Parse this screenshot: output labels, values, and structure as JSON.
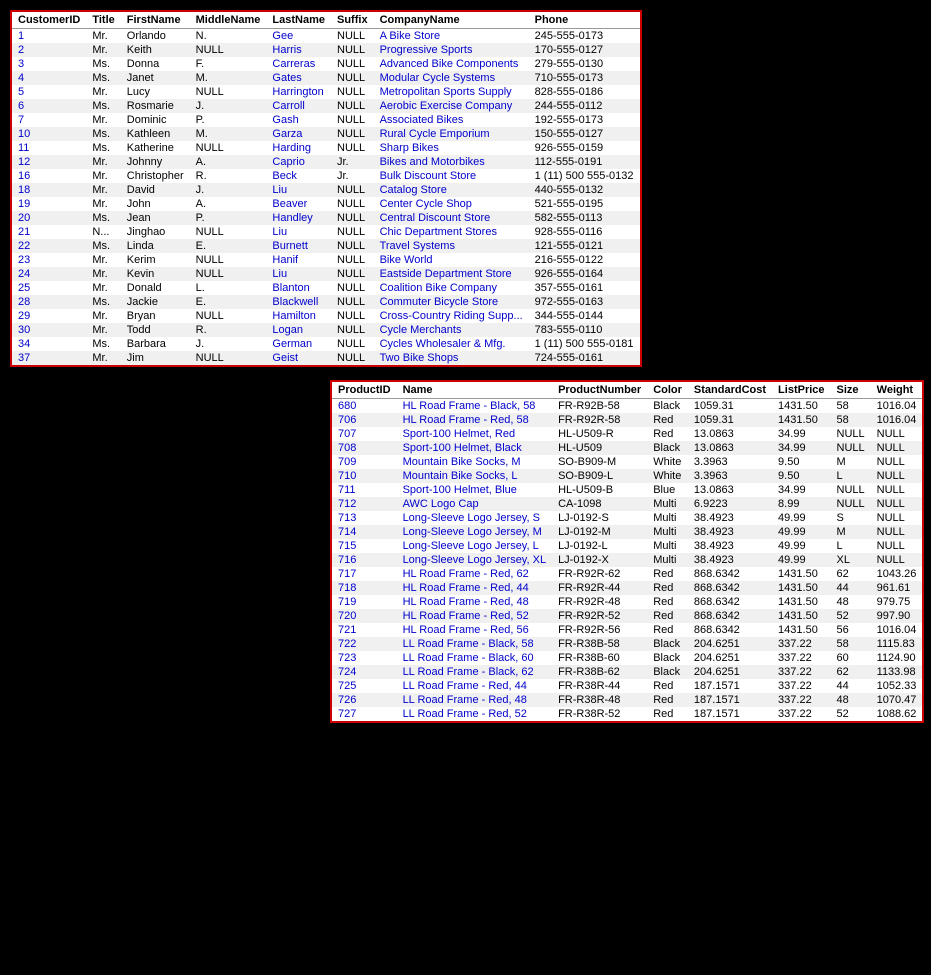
{
  "table1": {
    "columns": [
      "CustomerID",
      "Title",
      "FirstName",
      "MiddleName",
      "LastName",
      "Suffix",
      "CompanyName",
      "Phone"
    ],
    "rows": [
      [
        "1",
        "Mr.",
        "Orlando",
        "N.",
        "Gee",
        "NULL",
        "A Bike Store",
        "245-555-0173"
      ],
      [
        "2",
        "Mr.",
        "Keith",
        "NULL",
        "Harris",
        "NULL",
        "Progressive Sports",
        "170-555-0127"
      ],
      [
        "3",
        "Ms.",
        "Donna",
        "F.",
        "Carreras",
        "NULL",
        "Advanced Bike Components",
        "279-555-0130"
      ],
      [
        "4",
        "Ms.",
        "Janet",
        "M.",
        "Gates",
        "NULL",
        "Modular Cycle Systems",
        "710-555-0173"
      ],
      [
        "5",
        "Mr.",
        "Lucy",
        "NULL",
        "Harrington",
        "NULL",
        "Metropolitan Sports Supply",
        "828-555-0186"
      ],
      [
        "6",
        "Ms.",
        "Rosmarie",
        "J.",
        "Carroll",
        "NULL",
        "Aerobic Exercise Company",
        "244-555-0112"
      ],
      [
        "7",
        "Mr.",
        "Dominic",
        "P.",
        "Gash",
        "NULL",
        "Associated Bikes",
        "192-555-0173"
      ],
      [
        "10",
        "Ms.",
        "Kathleen",
        "M.",
        "Garza",
        "NULL",
        "Rural Cycle Emporium",
        "150-555-0127"
      ],
      [
        "11",
        "Ms.",
        "Katherine",
        "NULL",
        "Harding",
        "NULL",
        "Sharp Bikes",
        "926-555-0159"
      ],
      [
        "12",
        "Mr.",
        "Johnny",
        "A.",
        "Caprio",
        "Jr.",
        "Bikes and Motorbikes",
        "112-555-0191"
      ],
      [
        "16",
        "Mr.",
        "Christopher",
        "R.",
        "Beck",
        "Jr.",
        "Bulk Discount Store",
        "1 (11) 500 555-0132"
      ],
      [
        "18",
        "Mr.",
        "David",
        "J.",
        "Liu",
        "NULL",
        "Catalog Store",
        "440-555-0132"
      ],
      [
        "19",
        "Mr.",
        "John",
        "A.",
        "Beaver",
        "NULL",
        "Center Cycle Shop",
        "521-555-0195"
      ],
      [
        "20",
        "Ms.",
        "Jean",
        "P.",
        "Handley",
        "NULL",
        "Central Discount Store",
        "582-555-0113"
      ],
      [
        "21",
        "N...",
        "Jinghao",
        "NULL",
        "Liu",
        "NULL",
        "Chic Department Stores",
        "928-555-0116"
      ],
      [
        "22",
        "Ms.",
        "Linda",
        "E.",
        "Burnett",
        "NULL",
        "Travel Systems",
        "121-555-0121"
      ],
      [
        "23",
        "Mr.",
        "Kerim",
        "NULL",
        "Hanif",
        "NULL",
        "Bike World",
        "216-555-0122"
      ],
      [
        "24",
        "Mr.",
        "Kevin",
        "NULL",
        "Liu",
        "NULL",
        "Eastside Department Store",
        "926-555-0164"
      ],
      [
        "25",
        "Mr.",
        "Donald",
        "L.",
        "Blanton",
        "NULL",
        "Coalition Bike Company",
        "357-555-0161"
      ],
      [
        "28",
        "Ms.",
        "Jackie",
        "E.",
        "Blackwell",
        "NULL",
        "Commuter Bicycle Store",
        "972-555-0163"
      ],
      [
        "29",
        "Mr.",
        "Bryan",
        "NULL",
        "Hamilton",
        "NULL",
        "Cross-Country Riding Supp...",
        "344-555-0144"
      ],
      [
        "30",
        "Mr.",
        "Todd",
        "R.",
        "Logan",
        "NULL",
        "Cycle Merchants",
        "783-555-0110"
      ],
      [
        "34",
        "Ms.",
        "Barbara",
        "J.",
        "German",
        "NULL",
        "Cycles Wholesaler & Mfg.",
        "1 (11) 500 555-0181"
      ],
      [
        "37",
        "Mr.",
        "Jim",
        "NULL",
        "Geist",
        "NULL",
        "Two Bike Shops",
        "724-555-0161"
      ]
    ]
  },
  "table2": {
    "columns": [
      "ProductID",
      "Name",
      "ProductNumber",
      "Color",
      "StandardCost",
      "ListPrice",
      "Size",
      "Weight"
    ],
    "rows": [
      [
        "680",
        "HL Road Frame - Black, 58",
        "FR-R92B-58",
        "Black",
        "1059.31",
        "1431.50",
        "58",
        "1016.04"
      ],
      [
        "706",
        "HL Road Frame - Red, 58",
        "FR-R92R-58",
        "Red",
        "1059.31",
        "1431.50",
        "58",
        "1016.04"
      ],
      [
        "707",
        "Sport-100 Helmet, Red",
        "HL-U509-R",
        "Red",
        "13.0863",
        "34.99",
        "NULL",
        "NULL"
      ],
      [
        "708",
        "Sport-100 Helmet, Black",
        "HL-U509",
        "Black",
        "13.0863",
        "34.99",
        "NULL",
        "NULL"
      ],
      [
        "709",
        "Mountain Bike Socks, M",
        "SO-B909-M",
        "White",
        "3.3963",
        "9.50",
        "M",
        "NULL"
      ],
      [
        "710",
        "Mountain Bike Socks, L",
        "SO-B909-L",
        "White",
        "3.3963",
        "9.50",
        "L",
        "NULL"
      ],
      [
        "711",
        "Sport-100 Helmet, Blue",
        "HL-U509-B",
        "Blue",
        "13.0863",
        "34.99",
        "NULL",
        "NULL"
      ],
      [
        "712",
        "AWC Logo Cap",
        "CA-1098",
        "Multi",
        "6.9223",
        "8.99",
        "NULL",
        "NULL"
      ],
      [
        "713",
        "Long-Sleeve Logo Jersey, S",
        "LJ-0192-S",
        "Multi",
        "38.4923",
        "49.99",
        "S",
        "NULL"
      ],
      [
        "714",
        "Long-Sleeve Logo Jersey, M",
        "LJ-0192-M",
        "Multi",
        "38.4923",
        "49.99",
        "M",
        "NULL"
      ],
      [
        "715",
        "Long-Sleeve Logo Jersey, L",
        "LJ-0192-L",
        "Multi",
        "38.4923",
        "49.99",
        "L",
        "NULL"
      ],
      [
        "716",
        "Long-Sleeve Logo Jersey, XL",
        "LJ-0192-X",
        "Multi",
        "38.4923",
        "49.99",
        "XL",
        "NULL"
      ],
      [
        "717",
        "HL Road Frame - Red, 62",
        "FR-R92R-62",
        "Red",
        "868.6342",
        "1431.50",
        "62",
        "1043.26"
      ],
      [
        "718",
        "HL Road Frame - Red, 44",
        "FR-R92R-44",
        "Red",
        "868.6342",
        "1431.50",
        "44",
        "961.61"
      ],
      [
        "719",
        "HL Road Frame - Red, 48",
        "FR-R92R-48",
        "Red",
        "868.6342",
        "1431.50",
        "48",
        "979.75"
      ],
      [
        "720",
        "HL Road Frame - Red, 52",
        "FR-R92R-52",
        "Red",
        "868.6342",
        "1431.50",
        "52",
        "997.90"
      ],
      [
        "721",
        "HL Road Frame - Red, 56",
        "FR-R92R-56",
        "Red",
        "868.6342",
        "1431.50",
        "56",
        "1016.04"
      ],
      [
        "722",
        "LL Road Frame - Black, 58",
        "FR-R38B-58",
        "Black",
        "204.6251",
        "337.22",
        "58",
        "1115.83"
      ],
      [
        "723",
        "LL Road Frame - Black, 60",
        "FR-R38B-60",
        "Black",
        "204.6251",
        "337.22",
        "60",
        "1124.90"
      ],
      [
        "724",
        "LL Road Frame - Black, 62",
        "FR-R38B-62",
        "Black",
        "204.6251",
        "337.22",
        "62",
        "1133.98"
      ],
      [
        "725",
        "LL Road Frame - Red, 44",
        "FR-R38R-44",
        "Red",
        "187.1571",
        "337.22",
        "44",
        "1052.33"
      ],
      [
        "726",
        "LL Road Frame - Red, 48",
        "FR-R38R-48",
        "Red",
        "187.1571",
        "337.22",
        "48",
        "1070.47"
      ],
      [
        "727",
        "LL Road Frame - Red, 52",
        "FR-R38R-52",
        "Red",
        "187.1571",
        "337.22",
        "52",
        "1088.62"
      ]
    ]
  }
}
